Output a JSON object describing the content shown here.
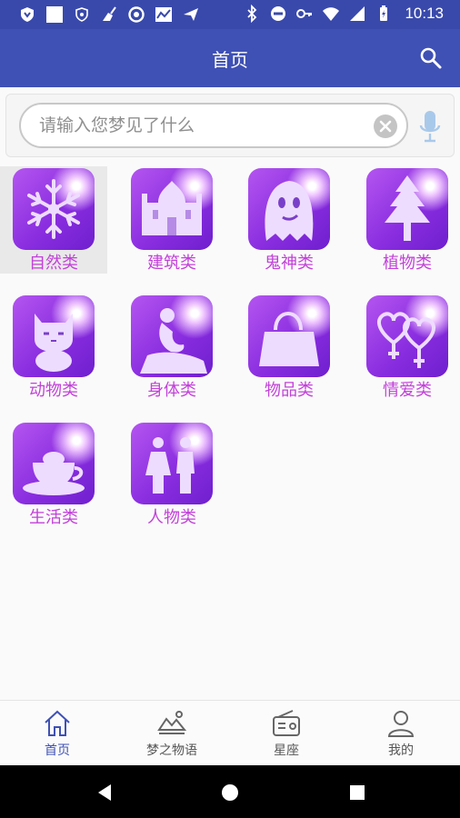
{
  "status_bar": {
    "time": "10:13",
    "left_icons": [
      "shield-icon",
      "square-icon",
      "vpn-icon",
      "broom-icon",
      "circle-icon",
      "chart-icon",
      "send-icon"
    ],
    "right_icons": [
      "bluetooth-icon",
      "do-not-disturb-icon",
      "key-icon",
      "wifi-icon",
      "signal-icon",
      "battery-icon"
    ]
  },
  "app_bar": {
    "title": "首页",
    "search_icon": "search-icon"
  },
  "search": {
    "placeholder": "请输入您梦见了什么",
    "value": "",
    "clear_icon": "clear-icon",
    "mic_icon": "microphone-icon"
  },
  "categories": [
    {
      "label": "自然类",
      "icon": "snowflake-icon",
      "selected": true
    },
    {
      "label": "建筑类",
      "icon": "palace-icon",
      "selected": false
    },
    {
      "label": "鬼神类",
      "icon": "ghost-icon",
      "selected": false
    },
    {
      "label": "植物类",
      "icon": "tree-icon",
      "selected": false
    },
    {
      "label": "动物类",
      "icon": "cat-icon",
      "selected": false
    },
    {
      "label": "身体类",
      "icon": "mermaid-statue-icon",
      "selected": false
    },
    {
      "label": "物品类",
      "icon": "handbag-icon",
      "selected": false
    },
    {
      "label": "情爱类",
      "icon": "hearts-icon",
      "selected": false
    },
    {
      "label": "生活类",
      "icon": "teacup-icon",
      "selected": false
    },
    {
      "label": "人物类",
      "icon": "people-icon",
      "selected": false
    }
  ],
  "colors": {
    "app_bar": "#3f51b5",
    "status_bar": "#3949ab",
    "category_label": "#c241d9",
    "tile_purple": "#8a2ee0",
    "nav_active": "#3f51b5"
  },
  "bottom_nav": [
    {
      "label": "首页",
      "icon": "home-icon",
      "active": true
    },
    {
      "label": "梦之物语",
      "icon": "landscape-icon",
      "active": false
    },
    {
      "label": "星座",
      "icon": "radio-icon",
      "active": false
    },
    {
      "label": "我的",
      "icon": "user-icon",
      "active": false
    }
  ],
  "system_nav": [
    "back-icon",
    "home-circle-icon",
    "recents-icon"
  ]
}
